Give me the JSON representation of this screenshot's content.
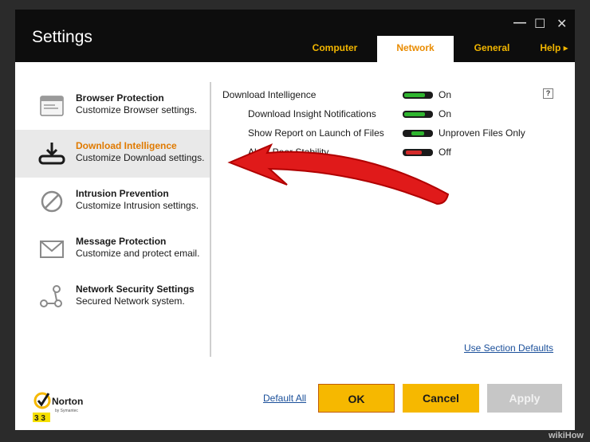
{
  "window": {
    "title": "Settings",
    "controls": {
      "minimize": "—",
      "maximize": "☐",
      "close": "✕"
    }
  },
  "tabs": [
    {
      "label": "Computer",
      "active": false
    },
    {
      "label": "Network",
      "active": true
    },
    {
      "label": "General",
      "active": false
    },
    {
      "label": "Help ▸",
      "active": false
    }
  ],
  "sidebar": {
    "items": [
      {
        "title": "Browser Protection",
        "subtitle": "Customize Browser settings.",
        "icon": "browser-icon"
      },
      {
        "title": "Download Intelligence",
        "subtitle": "Customize Download settings.",
        "icon": "download-icon",
        "active": true
      },
      {
        "title": "Intrusion Prevention",
        "subtitle": "Customize Intrusion settings.",
        "icon": "prohibited-icon"
      },
      {
        "title": "Message Protection",
        "subtitle": "Customize and protect email.",
        "icon": "envelope-icon"
      },
      {
        "title": "Network Security Settings",
        "subtitle": "Secured Network system.",
        "icon": "network-icon"
      }
    ]
  },
  "settings": {
    "help_label": "?",
    "rows": [
      {
        "label": "Download Intelligence",
        "value": "On",
        "state": "on",
        "color": "#2fb52f"
      },
      {
        "label": "Download Insight Notifications",
        "value": "On",
        "state": "on",
        "color": "#2fb52f"
      },
      {
        "label": "Show Report on Launch of Files",
        "value": "Unproven Files Only",
        "state": "partial",
        "color": "#2fb52f"
      },
      {
        "label": "Al... / Poor Stability",
        "value": "Off",
        "state": "off",
        "color": "#d42a2a"
      }
    ]
  },
  "links": {
    "section_defaults": "Use Section Defaults",
    "default_all": "Default All"
  },
  "buttons": {
    "ok": "OK",
    "cancel": "Cancel",
    "apply": "Apply"
  },
  "brand": {
    "name": "Norton",
    "sub": "by Symantec",
    "accent": "#f6b800"
  },
  "watermark": "wikiHow"
}
